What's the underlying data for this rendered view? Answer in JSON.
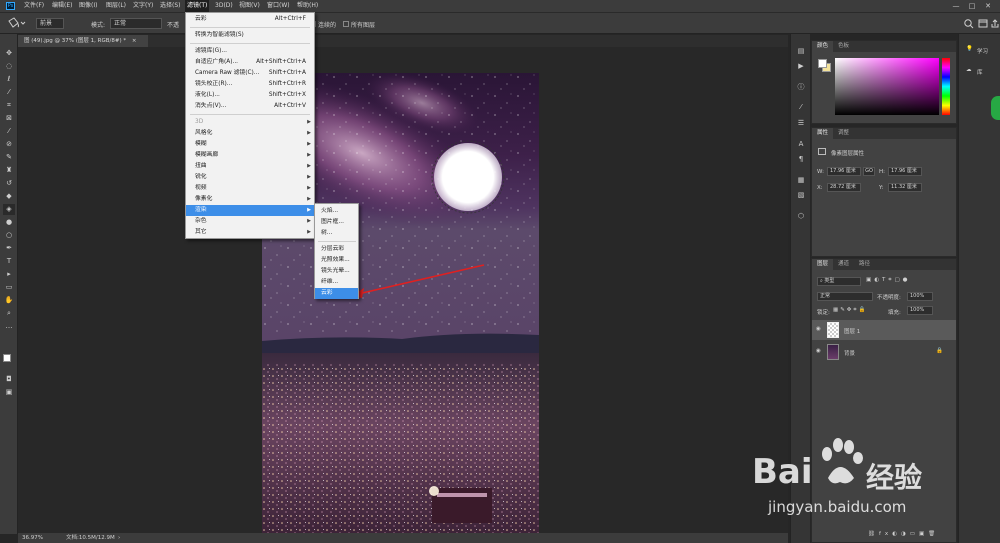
{
  "app": {
    "logo": "Ps"
  },
  "menubar": {
    "items": [
      "文件(F)",
      "编辑(E)",
      "图像(I)",
      "图层(L)",
      "文字(Y)",
      "选择(S)",
      "滤镜(T)",
      "3D(D)",
      "视图(V)",
      "窗口(W)",
      "帮助(H)"
    ],
    "active_index": 6
  },
  "window_controls": [
    "—",
    "□",
    "✕"
  ],
  "options": {
    "fill_source": "前景",
    "mode_label": "模式:",
    "mode_value": "正常",
    "opacity_label_partial": "不透",
    "contiguous_label": "连续的",
    "all_layers_label": "所有图层",
    "search_icon": "search-icon",
    "workspace_icon": "workspace-icon",
    "share_icon": "share-icon"
  },
  "document": {
    "tab_title": "图 (49).jpg @ 37% (图层 1, RGB/8#) *",
    "close": "×"
  },
  "status": {
    "zoom": "36.97%",
    "doc_size": "文档:10.5M/12.9M"
  },
  "filter_menu": {
    "items": [
      {
        "label": "云彩",
        "shortcut": "Alt+Ctrl+F"
      },
      {
        "label": "转换为智能滤镜(S)"
      },
      {
        "label": "滤镜库(G)..."
      },
      {
        "label": "自适应广角(A)...",
        "shortcut": "Alt+Shift+Ctrl+A"
      },
      {
        "label": "Camera Raw 滤镜(C)...",
        "shortcut": "Shift+Ctrl+A"
      },
      {
        "label": "镜头校正(R)...",
        "shortcut": "Shift+Ctrl+R"
      },
      {
        "label": "液化(L)...",
        "shortcut": "Shift+Ctrl+X"
      },
      {
        "label": "消失点(V)...",
        "shortcut": "Alt+Ctrl+V"
      },
      {
        "label": "3D"
      },
      {
        "label": "风格化"
      },
      {
        "label": "模糊"
      },
      {
        "label": "模糊画廊"
      },
      {
        "label": "扭曲"
      },
      {
        "label": "锐化"
      },
      {
        "label": "视频"
      },
      {
        "label": "像素化"
      },
      {
        "label": "渲染"
      },
      {
        "label": "杂色"
      },
      {
        "label": "其它"
      }
    ]
  },
  "render_submenu": {
    "items": [
      "火焰...",
      "图片框...",
      "树...",
      "分层云彩",
      "光照效果...",
      "镜头光晕...",
      "纤维...",
      "云彩"
    ],
    "highlight_index": 7
  },
  "color_panel": {
    "tabs": [
      "颜色",
      "色板"
    ],
    "hue_accent": "#ff00ff"
  },
  "properties_panel": {
    "tabs": [
      "属性",
      "调整"
    ],
    "section_title": "像素图层属性",
    "w_label": "W:",
    "w_value": "17.96 厘米",
    "link_label": "GO",
    "h_label": "H:",
    "h_value": "17.96 厘米",
    "x_label": "X:",
    "x_value": "28.72 厘米",
    "y_label": "Y:",
    "y_value": "11.32 厘米"
  },
  "layers_panel": {
    "tabs": [
      "图层",
      "通道",
      "路径"
    ],
    "filter_kind": "类型",
    "blend_mode": "正常",
    "opacity_label": "不透明度:",
    "opacity_value": "100%",
    "lock_label": "锁定:",
    "fill_label": "填充:",
    "fill_value": "100%",
    "layers": [
      {
        "name": "图层 1",
        "selected": true
      },
      {
        "name": "背景",
        "selected": false,
        "locked": true
      }
    ]
  },
  "far_right": {
    "learn": "学习",
    "library": "库"
  },
  "watermark": {
    "brand": "Bai",
    "brand_cn": "经验",
    "url": "jingyan.baidu.com"
  }
}
